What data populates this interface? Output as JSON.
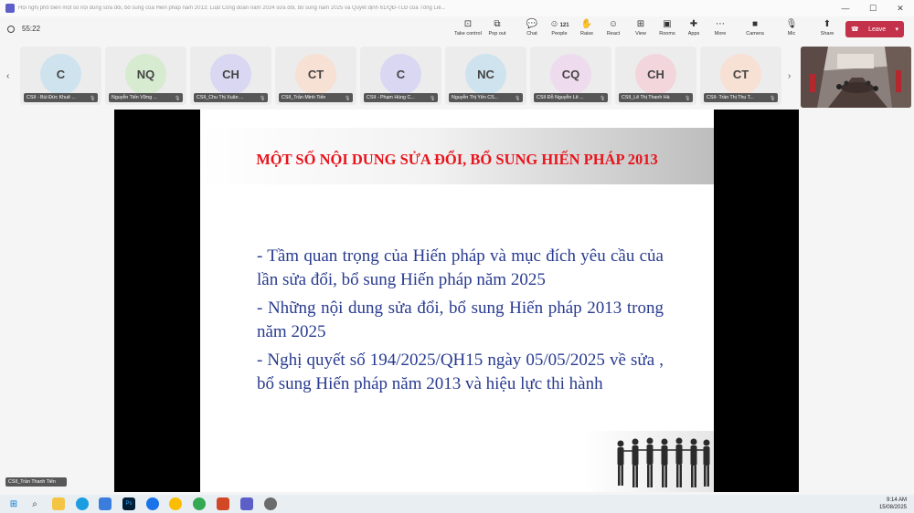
{
  "window": {
    "title": "Hội nghị phổ biến một số nội dung sửa đổi, bổ sung của Hiến pháp năm 2013; Luật Công đoàn năm 2024 sửa đổi, bổ sung năm 2025 và Quyết định 61/QĐ-TLĐ của Tổng Liê...",
    "minimize": "—",
    "maximize": "☐",
    "close": "✕"
  },
  "meeting": {
    "elapsed": "55:22"
  },
  "toolbar": {
    "take_control": "Take control",
    "pop_out": "Pop out",
    "chat": "Chat",
    "people": "People",
    "people_count": "121",
    "raise": "Raise",
    "react": "React",
    "view": "View",
    "rooms": "Rooms",
    "apps": "Apps",
    "more": "More",
    "camera": "Camera",
    "mic": "Mic",
    "share": "Share",
    "leave": "Leave"
  },
  "participants": [
    {
      "initials": "C",
      "name": "CSII - Bùi Đức Khuê ...",
      "color": "#cfe3ee"
    },
    {
      "initials": "NQ",
      "name": "Nguyễn Tiến Vững ...",
      "color": "#d6ebd0"
    },
    {
      "initials": "CH",
      "name": "CSII_Chu Thị Xuân ...",
      "color": "#d9d7f2"
    },
    {
      "initials": "CT",
      "name": "CSII_Trần Minh Tiến",
      "color": "#f7e0d4"
    },
    {
      "initials": "C",
      "name": "CSII - Phạm Hùng C...",
      "color": "#d9d7f2"
    },
    {
      "initials": "NC",
      "name": "Nguyễn Thị Yến CS...",
      "color": "#cfe3ee"
    },
    {
      "initials": "CQ",
      "name": "CSII Đỗ Nguyễn Lê ...",
      "color": "#eedcee"
    },
    {
      "initials": "CH",
      "name": "CSII_Lê Thị Thanh Hà",
      "color": "#f2d6dc"
    },
    {
      "initials": "CT",
      "name": "CSII- Trần Thị Thu T...",
      "color": "#f7e0d4"
    }
  ],
  "slide": {
    "title": "MỘT SỐ NỘI DUNG SỬA ĐỔI, BỔ SUNG HIẾN PHÁP 2013",
    "bullets": [
      "- Tầm quan trọng của Hiến pháp và mục đích yêu cầu của lần sửa đổi, bổ sung Hiến pháp năm 2025",
      "- Những nội dung sửa đổi, bổ sung Hiến pháp 2013 trong năm 2025",
      "- Nghị quyết số 194/2025/QH15 ngày 05/05/2025 về sửa , bổ sung Hiến pháp năm 2013 và hiệu lực thi hành"
    ]
  },
  "self_view": {
    "name": "CSII_Trần Thanh Tiến"
  },
  "taskbar": {
    "time": "9:14 AM",
    "date": "15/08/2025"
  },
  "colors": {
    "leave": "#c4314b",
    "slide_title": "#e8141c",
    "slide_text": "#283b8f",
    "teams": "#5b5fc7"
  }
}
